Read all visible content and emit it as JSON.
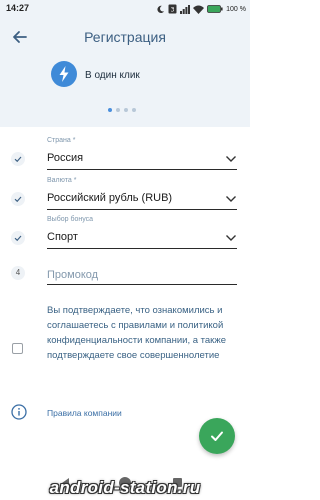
{
  "status_bar": {
    "time": "14:27",
    "battery": "100 %",
    "sim_label": "3"
  },
  "header": {
    "title": "Регистрация"
  },
  "method": {
    "label": "В один клик",
    "page_count": 4,
    "active_index": 0
  },
  "form": {
    "country": {
      "label": "Страна *",
      "value": "Россия"
    },
    "currency": {
      "label": "Валюта *",
      "value": "Российский рубль (RUB)"
    },
    "bonus": {
      "label": "Выбор бонуса",
      "value": "Спорт"
    },
    "promo": {
      "number": "4",
      "placeholder": "Промокод",
      "value": ""
    },
    "agreement": {
      "checked": false,
      "text": "Вы подтверждаете, что ознакомились и соглашаетесь с правилами и политикой конфиденциальности компании, а также подтверждаете свое совершеннолетие"
    },
    "rules_link": "Правила компании"
  },
  "watermark": "android-station.ru",
  "colors": {
    "accent": "#4a8fdd",
    "title": "#3c5f82",
    "fab": "#3aa65b",
    "header_bg": "#eef3f8"
  }
}
